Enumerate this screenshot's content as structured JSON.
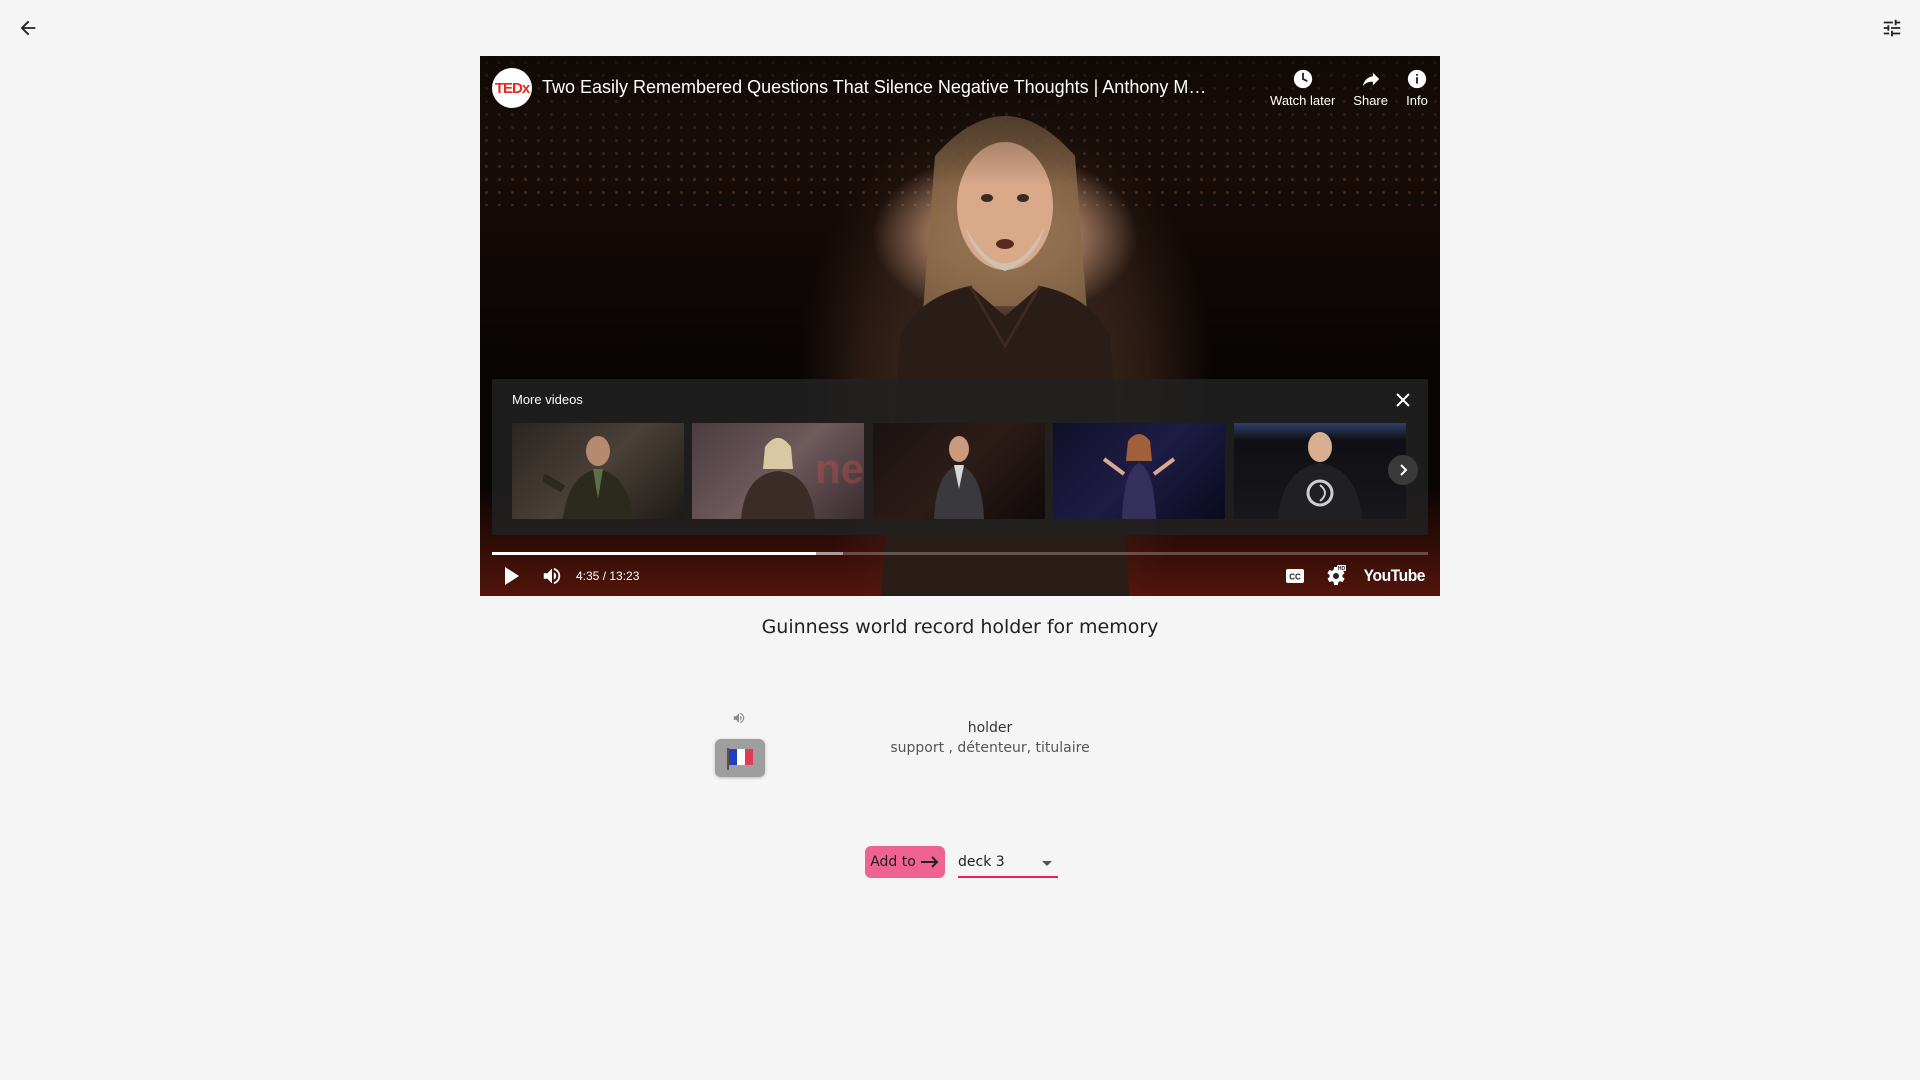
{
  "video": {
    "channel_logo_text": "TEDx",
    "title": "Two Easily Remembered Questions That Silence Negative Thoughts | Anthony Metivier | TEDxGreenville",
    "actions": [
      {
        "label": "Watch later",
        "icon": "clock-icon"
      },
      {
        "label": "Share",
        "icon": "share-icon"
      },
      {
        "label": "Info",
        "icon": "info-icon"
      }
    ],
    "more_videos": {
      "label": "More videos",
      "thumbnails": 5
    },
    "progress": {
      "played_fraction": 0.346,
      "buffered_fraction": 0.375
    },
    "time": "4:35 / 13:23",
    "brand": "YouTube"
  },
  "caption": "Guinness world record holder for memory",
  "lookup": {
    "word": "holder",
    "translations": "support ,  détenteur,  titulaire",
    "language_flag": "france-flag"
  },
  "add": {
    "button_label": "Add to",
    "deck": "deck 3"
  },
  "colors": {
    "accent": "#e91e63",
    "button": "#f06292",
    "background": "#f5f5f5"
  }
}
